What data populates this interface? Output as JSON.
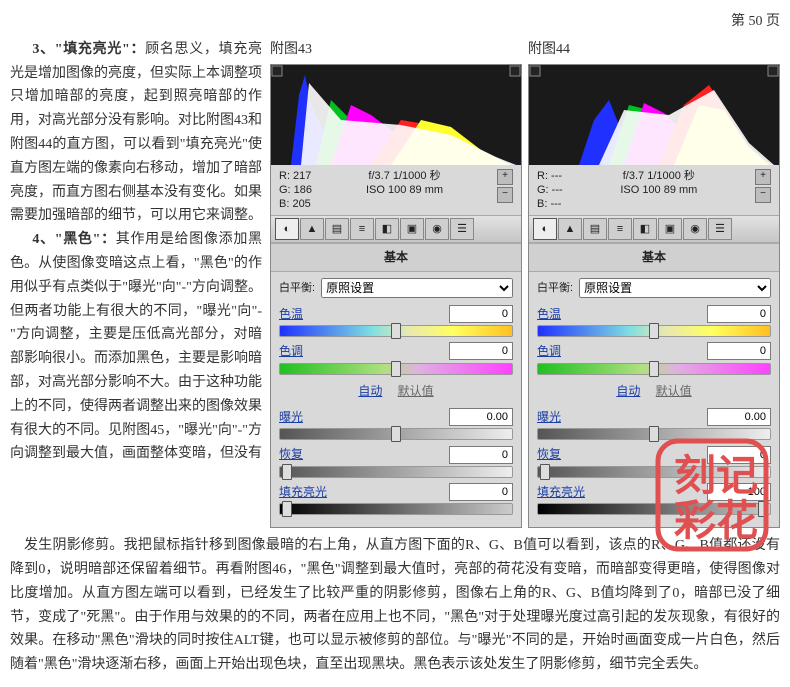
{
  "page_header": "第 50 页",
  "para1_a": "3、",
  "para1_b": "\"填充亮光\"：",
  "para1_c": "顾名思义，填充亮光是增加图像的亮度，但实际上本调整项只增加暗部的亮度，起到照亮暗部的作用，对高光部分没有影响。对比附图43和附图44的直方图，可以看到\"填充亮光\"使直方图左端的像素向右移动，增加了暗部亮度，而直方图右侧基本没有变化。如果需要加强暗部的细节，可以用它来调整。",
  "para2_a": "4、",
  "para2_b": "\"黑色\"：",
  "para2_c": "其作用是给图像添加黑色。从使图像变暗这点上看，\"黑色\"的作用似乎有点类似于\"曝光\"向\"-\"方向调整。但两者功能上有很大的不同，\"曝光\"向\"-\"方向调整，主要是压低高光部分，对暗部影响很小。而添加黑色，主要是影响暗部，对高光部分影响不大。由于这种功能上的不同，使得两者调整出来的图像效果有很大的不同。见附图45，\"曝光\"向\"-\"方向调整到最大值，画面整体变暗，但没有",
  "para3": "发生阴影修剪。我把鼠标指针移到图像最暗的右上角，从直方图下面的R、G、B值可以看到，该点的R、G、B值都还没有降到0，说明暗部还保留着细节。再看附图46，\"黑色\"调整到最大值时，亮部的荷花没有变暗，而暗部变得更暗，使得图像对比度增加。从直方图左端可以看到，已经发生了比较严重的阴影修剪，图像右上角的R、G、B值均降到了0，暗部已没了细节，变成了\"死黑\"。由于作用与效果的的不同，两者在应用上也不同，\"黑色\"对于处理曝光度过高引起的发灰现象，有很好的效果。在移动\"黑色\"滑块的同时按住ALT键，也可以显示被修剪的部位。与\"曝光\"不同的是，开始时画面变成一片白色，然后随着\"黑色\"滑块逐渐右移，画面上开始出现色块，直至出现黑块。黑色表示该处发生了阴影修剪，细节完全丢失。",
  "figure43": {
    "label": "附图43",
    "rgb": {
      "R": "R:  217",
      "G": "G:  186",
      "B": "B:  205"
    },
    "exif_line1": "f/3.7  1/1000 秒",
    "exif_line2": "ISO 100   89 mm"
  },
  "figure44": {
    "label": "附图44",
    "rgb": {
      "R": "R:  ---",
      "G": "G:  ---",
      "B": "B:  ---"
    },
    "exif_line1": "f/3.7  1/1000 秒",
    "exif_line2": "ISO 100   89 mm"
  },
  "panel_common": {
    "section_title": "基本",
    "wb_label": "白平衡:",
    "wb_value": "原照设置",
    "labels": {
      "temp": "色温",
      "tint": "色调",
      "auto": "自动",
      "default": "默认值",
      "exposure": "曝光",
      "recovery": "恢复",
      "fill": "填充亮光"
    }
  },
  "panel_left": {
    "values": {
      "temp": "0",
      "tint": "0",
      "exposure": "0.00",
      "recovery": "0",
      "fill": "0"
    },
    "fill_pos": "3%"
  },
  "panel_right": {
    "values": {
      "temp": "0",
      "tint": "0",
      "exposure": "0.00",
      "recovery": "0",
      "fill": "100"
    },
    "fill_pos": "97%"
  }
}
